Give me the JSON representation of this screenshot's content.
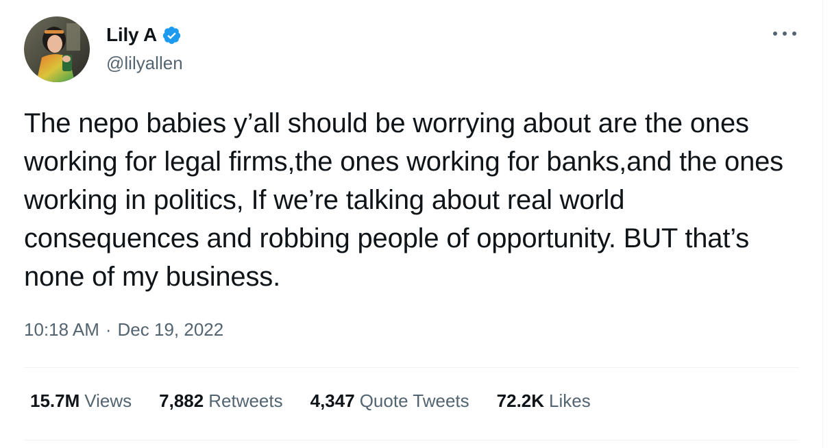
{
  "author": {
    "display_name": "Lily A",
    "handle": "@lilyallen",
    "verified_icon": "verified-badge-icon",
    "verified_color": "#1d9bf0"
  },
  "more_icon": "more-horizontal-icon",
  "tweet": {
    "text": "The nepo babies y’all should be worrying about are the ones working for legal firms,the ones working for banks,and the ones working in politics, If we’re talking about real world consequences and robbing people of opportunity. BUT that’s none of my business."
  },
  "timestamp": {
    "time": "10:18 AM",
    "separator": "·",
    "date": "Dec 19, 2022"
  },
  "stats": {
    "views": {
      "value": "15.7M",
      "label": "Views"
    },
    "retweets": {
      "value": "7,882",
      "label": "Retweets"
    },
    "quote_tweets": {
      "value": "4,347",
      "label": "Quote Tweets"
    },
    "likes": {
      "value": "72.2K",
      "label": "Likes"
    }
  },
  "colors": {
    "text_primary": "#0f1419",
    "text_secondary": "#536471",
    "divider": "#eff3f4",
    "accent": "#1d9bf0"
  }
}
